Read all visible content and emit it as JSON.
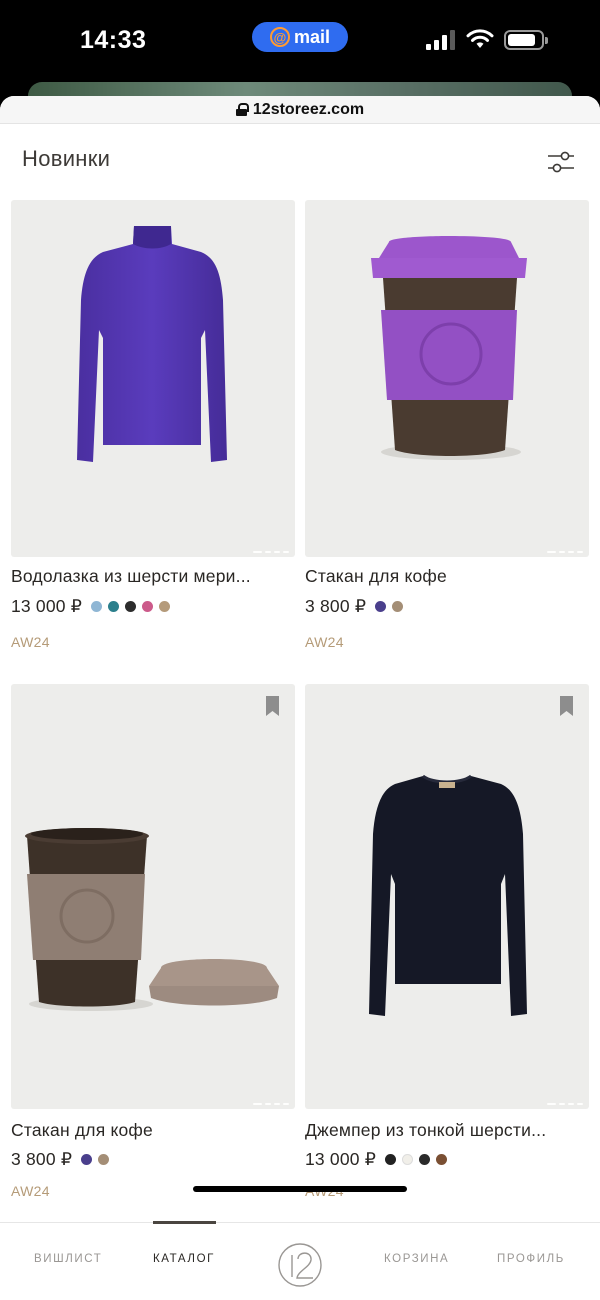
{
  "status_bar": {
    "time": "14:33",
    "mail_label": "mail",
    "mail_icon_char": "@",
    "signal_bars": 4,
    "signal_bars_active": 3
  },
  "browser": {
    "url": "12storeez.com"
  },
  "header": {
    "title": "Новинки",
    "filter_icon": "filter-sliders-icon"
  },
  "products": [
    {
      "name": "Водолазка из шерсти мери...",
      "price": "13 000 ₽",
      "season": "AW24",
      "swatches": [
        "#8fb6d4",
        "#2b7f8c",
        "#2c2c2c",
        "#cc5a8a",
        "#b49a7a"
      ],
      "bookmark": false
    },
    {
      "name": "Стакан для кофе",
      "price": "3 800 ₽",
      "season": "AW24",
      "swatches": [
        "#4a3f8c",
        "#a48e76"
      ],
      "bookmark": false
    },
    {
      "name": "Стакан для кофе",
      "price": "3 800 ₽",
      "season": "AW24",
      "swatches": [
        "#4a3f8c",
        "#a48e76"
      ],
      "bookmark": true
    },
    {
      "name": "Джемпер из тонкой шерсти...",
      "price": "13 000 ₽",
      "season": "AW24",
      "swatches": [
        "#222222",
        "#f1efe9",
        "#2a2a2a",
        "#7a4f33"
      ],
      "bookmark": true
    }
  ],
  "bottom_nav": {
    "items": [
      "ВИШЛИСТ",
      "КАТАЛОГ",
      "КОРЗИНА",
      "ПРОФИЛЬ"
    ],
    "active": "КАТАЛОГ",
    "logo_icon": "12storeez-logo-icon"
  },
  "colors": {
    "accent_mail": "#2f6cf0",
    "season_label": "#b59b78",
    "card_bg": "#ededeb",
    "text_primary": "#2a2724"
  }
}
